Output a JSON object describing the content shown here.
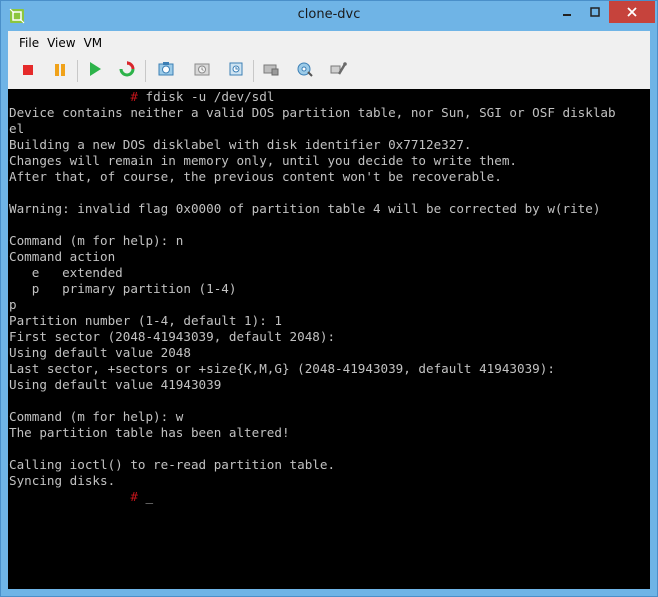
{
  "window": {
    "title": "clone-dvc"
  },
  "menubar": {
    "items": [
      "File",
      "View",
      "VM"
    ]
  },
  "toolbar": {
    "buttons": [
      {
        "name": "power-off",
        "icon": "red-square-icon"
      },
      {
        "name": "suspend",
        "icon": "orange-pause-icon"
      },
      {
        "name": "power-on",
        "icon": "green-play-icon"
      },
      {
        "name": "reset",
        "icon": "red-green-refresh-icon"
      },
      {
        "name": "snapshot",
        "icon": "camera-icon"
      },
      {
        "name": "revert-snapshot",
        "icon": "clock-revert-icon"
      },
      {
        "name": "snapshot-manager",
        "icon": "snapshot-manager-icon"
      },
      {
        "name": "cd-dvd",
        "icon": "disk-icon"
      },
      {
        "name": "floppy",
        "icon": "gear-disk-icon"
      },
      {
        "name": "network",
        "icon": "network-wrench-icon"
      }
    ]
  },
  "console": {
    "prompt_symbol": "#",
    "first_command": " fdisk -u /dev/sdl",
    "lines": [
      "Device contains neither a valid DOS partition table, nor Sun, SGI or OSF disklab",
      "el",
      "Building a new DOS disklabel with disk identifier 0x7712e327.",
      "Changes will remain in memory only, until you decide to write them.",
      "After that, of course, the previous content won't be recoverable.",
      "",
      "Warning: invalid flag 0x0000 of partition table 4 will be corrected by w(rite)",
      "",
      "Command (m for help): n",
      "Command action",
      "   e   extended",
      "   p   primary partition (1-4)",
      "p",
      "Partition number (1-4, default 1): 1",
      "First sector (2048-41943039, default 2048):",
      "Using default value 2048",
      "Last sector, +sectors or +size{K,M,G} (2048-41943039, default 41943039):",
      "Using default value 41943039",
      "",
      "Command (m for help): w",
      "The partition table has been altered!",
      "",
      "Calling ioctl() to re-read partition table.",
      "Syncing disks."
    ],
    "final_prompt": "#",
    "cursor": " _"
  },
  "colors": {
    "title_bar": "#6fb4e6",
    "console_bg": "#000000",
    "console_text": "#c2c2c2",
    "prompt": "#c2141a",
    "close_button": "#c6433c"
  }
}
